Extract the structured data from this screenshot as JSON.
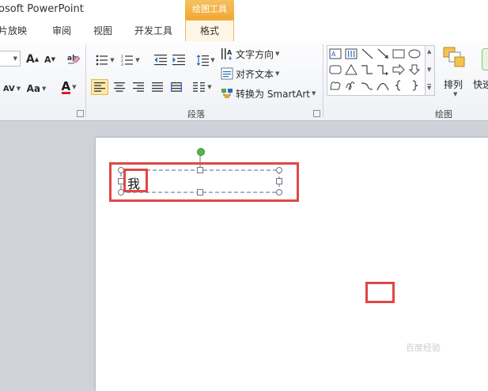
{
  "app": {
    "title": "osoft PowerPoint",
    "context_tab": "绘图工具"
  },
  "tabs": [
    {
      "label": "片放映"
    },
    {
      "label": "审阅"
    },
    {
      "label": "视图"
    },
    {
      "label": "开发工具"
    },
    {
      "label": "格式"
    }
  ],
  "ribbon": {
    "font_group": {
      "font_size_value": "",
      "grow_font": "A",
      "shrink_font": "A",
      "char_spacing": "AV",
      "change_case": "Aa",
      "font_color": "A"
    },
    "paragraph_group": {
      "label": "段落",
      "text_direction": "文字方向",
      "align_text": "对齐文本",
      "convert_smartart": "转换为 SmartArt"
    },
    "drawing_group": {
      "label": "绘图",
      "arrange": "排列",
      "quick_styles": "快速"
    }
  },
  "slide": {
    "textbox_text": "我"
  },
  "watermark": "百度经验",
  "colors": {
    "highlight_red": "#e04646",
    "context_orange": "#f0a631",
    "rotate_handle": "#54b848"
  }
}
